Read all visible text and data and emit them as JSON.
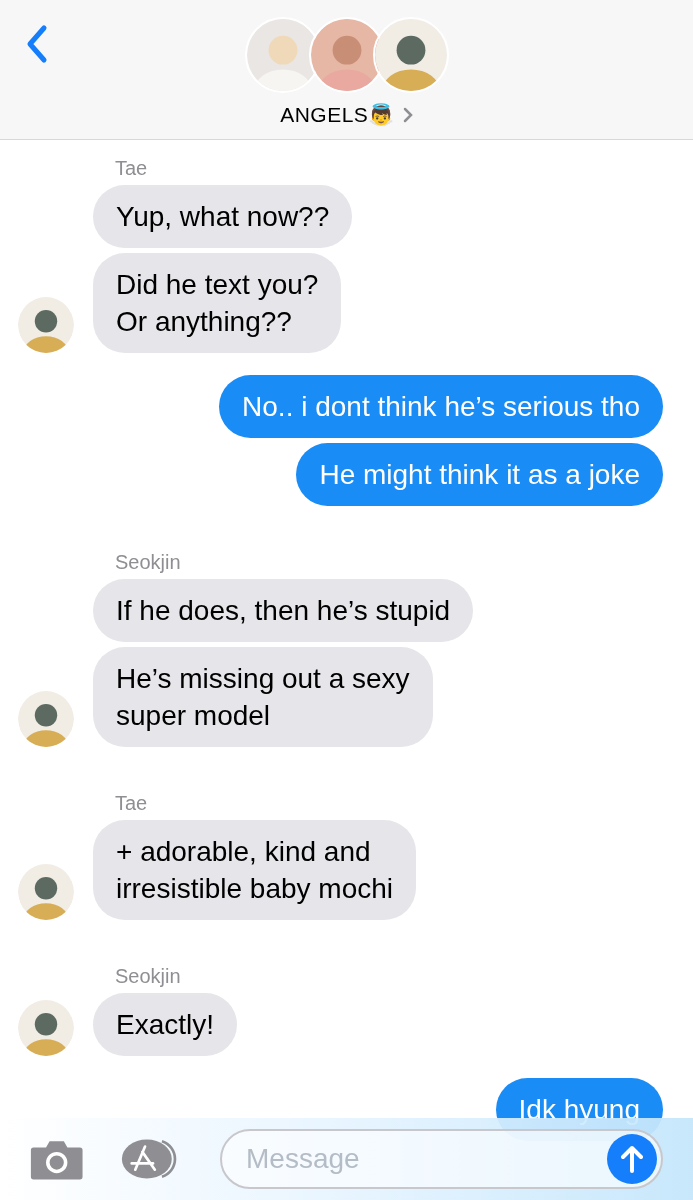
{
  "header": {
    "title": "ANGELS👼"
  },
  "messages": [
    {
      "kind": "received",
      "sender": "Tae",
      "bubbles": [
        "Yup, what now??",
        "Did he text you?\nOr anything??"
      ]
    },
    {
      "kind": "sent",
      "bubbles": [
        "No.. i dont think he’s serious tho",
        "He might think it as a joke"
      ]
    },
    {
      "kind": "received",
      "sender": "Seokjin",
      "bubbles": [
        "If he does, then he’s stupid",
        "He’s missing out a sexy\nsuper model"
      ]
    },
    {
      "kind": "received",
      "sender": "Tae",
      "bubbles": [
        "+ adorable, kind and\nirresistible baby mochi"
      ]
    },
    {
      "kind": "received",
      "sender": "Seokjin",
      "bubbles": [
        "Exactly!"
      ]
    },
    {
      "kind": "sent",
      "bubbles": [
        "Idk hyung"
      ]
    }
  ],
  "composer": {
    "placeholder": "Message"
  }
}
